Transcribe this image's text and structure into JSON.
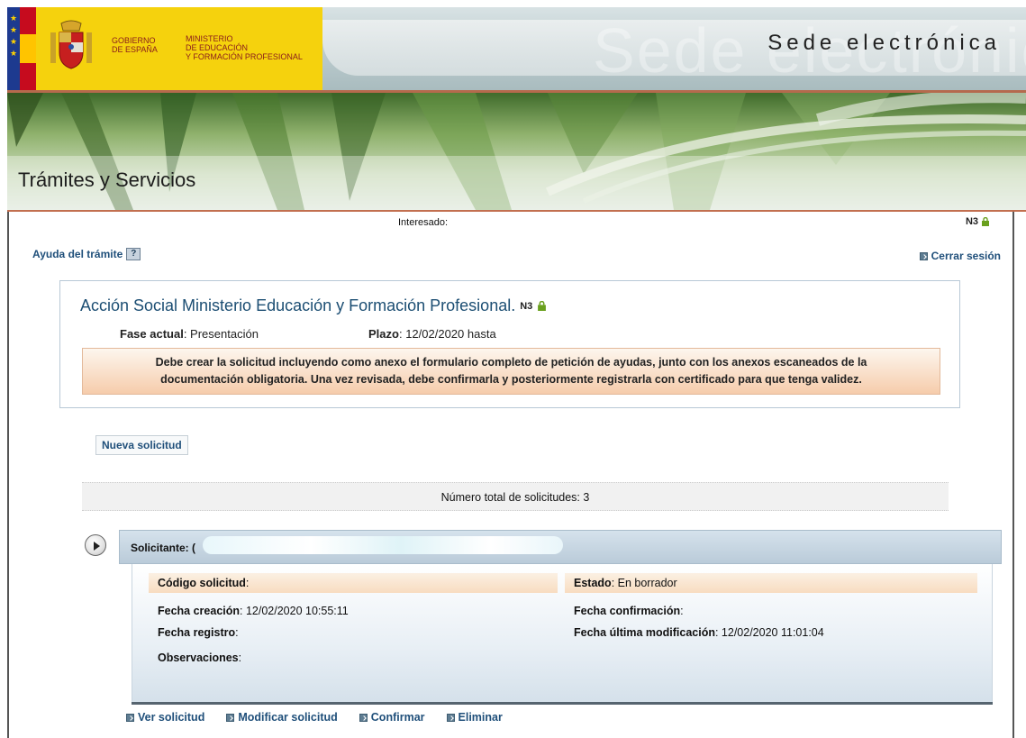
{
  "header": {
    "gov_line1": "GOBIERNO",
    "gov_line2": "DE ESPAÑA",
    "ministry_line1": "MINISTERIO",
    "ministry_line2": "DE EDUCACIÓN",
    "ministry_line3": "Y FORMACIÓN PROFESIONAL",
    "site_title": "Sede electrónica",
    "watermark": "Sede electrónica"
  },
  "banner": {
    "title": "Trámites y Servicios"
  },
  "session": {
    "interesado_label": "Interesado:",
    "level": "N3",
    "help_link": "Ayuda del trámite",
    "help_icon": "?",
    "logout": "Cerrar sesión"
  },
  "procedure": {
    "title": "Acción Social Ministerio Educación y Formación Profesional.",
    "level": "N3",
    "fase_label": "Fase actual",
    "fase_value": ": Presentación",
    "plazo_label": "Plazo",
    "plazo_value": ": 12/02/2020 hasta",
    "notice_line1": "Debe crear la solicitud incluyendo como anexo el formulario completo de petición de ayudas, junto con los anexos escaneados de la",
    "notice_line2": "documentación obligatoria. Una vez revisada, debe confirmarla y posteriormente registrarla con certificado para que tenga validez."
  },
  "new_request_button": "Nueva solicitud",
  "total": "Número total de solicitudes: 3",
  "request": {
    "solicitante_label": "Solicitante: (",
    "codigo_label": "Código solicitud",
    "codigo_value": ":",
    "estado_label": "Estado",
    "estado_value": ":  En borrador",
    "fecha_creacion_label": "Fecha creación",
    "fecha_creacion_value": ": 12/02/2020 10:55:11",
    "fecha_confirmacion_label": "Fecha confirmación",
    "fecha_confirmacion_value": ":",
    "fecha_registro_label": "Fecha registro",
    "fecha_registro_value": ":",
    "fecha_modificacion_label": "Fecha última modificación",
    "fecha_modificacion_value": ":  12/02/2020 11:01:04",
    "observaciones_label": "Observaciones",
    "observaciones_value": ":"
  },
  "actions": [
    "Ver solicitud",
    "Modificar solicitud",
    "Confirmar",
    "Eliminar"
  ],
  "colors": {
    "link": "#1f4f7a",
    "title": "#1c4e73",
    "notice_bg": "#f6ccab",
    "header_band": "#f5d20d"
  }
}
